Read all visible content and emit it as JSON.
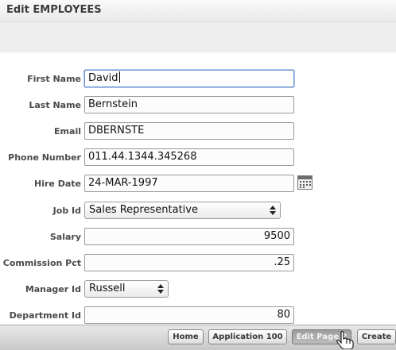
{
  "header": {
    "title": "Edit EMPLOYEES"
  },
  "form": {
    "first_name": {
      "label": "First Name",
      "value": "David"
    },
    "last_name": {
      "label": "Last Name",
      "value": "Bernstein"
    },
    "email": {
      "label": "Email",
      "value": "DBERNSTE"
    },
    "phone_number": {
      "label": "Phone Number",
      "value": "011.44.1344.345268"
    },
    "hire_date": {
      "label": "Hire Date",
      "value": "24-MAR-1997",
      "icon": "calendar-icon"
    },
    "job_id": {
      "label": "Job Id",
      "selected": "Sales Representative"
    },
    "salary": {
      "label": "Salary",
      "value": "9500"
    },
    "commission_pct": {
      "label": "Commission Pct",
      "value": ".25"
    },
    "manager_id": {
      "label": "Manager Id",
      "selected": "Russell"
    },
    "department_id": {
      "label": "Department Id",
      "value": "80"
    }
  },
  "developer_toolbar": {
    "home": "Home",
    "application": "Application 100",
    "edit_page": "Edit Page 2",
    "create": "Create"
  },
  "colors": {
    "focus_border": "#6f94c8",
    "label_text": "#4a4a4a",
    "toolbar_bg": "#d8d8d8",
    "band_bg": "#eeeeee"
  }
}
